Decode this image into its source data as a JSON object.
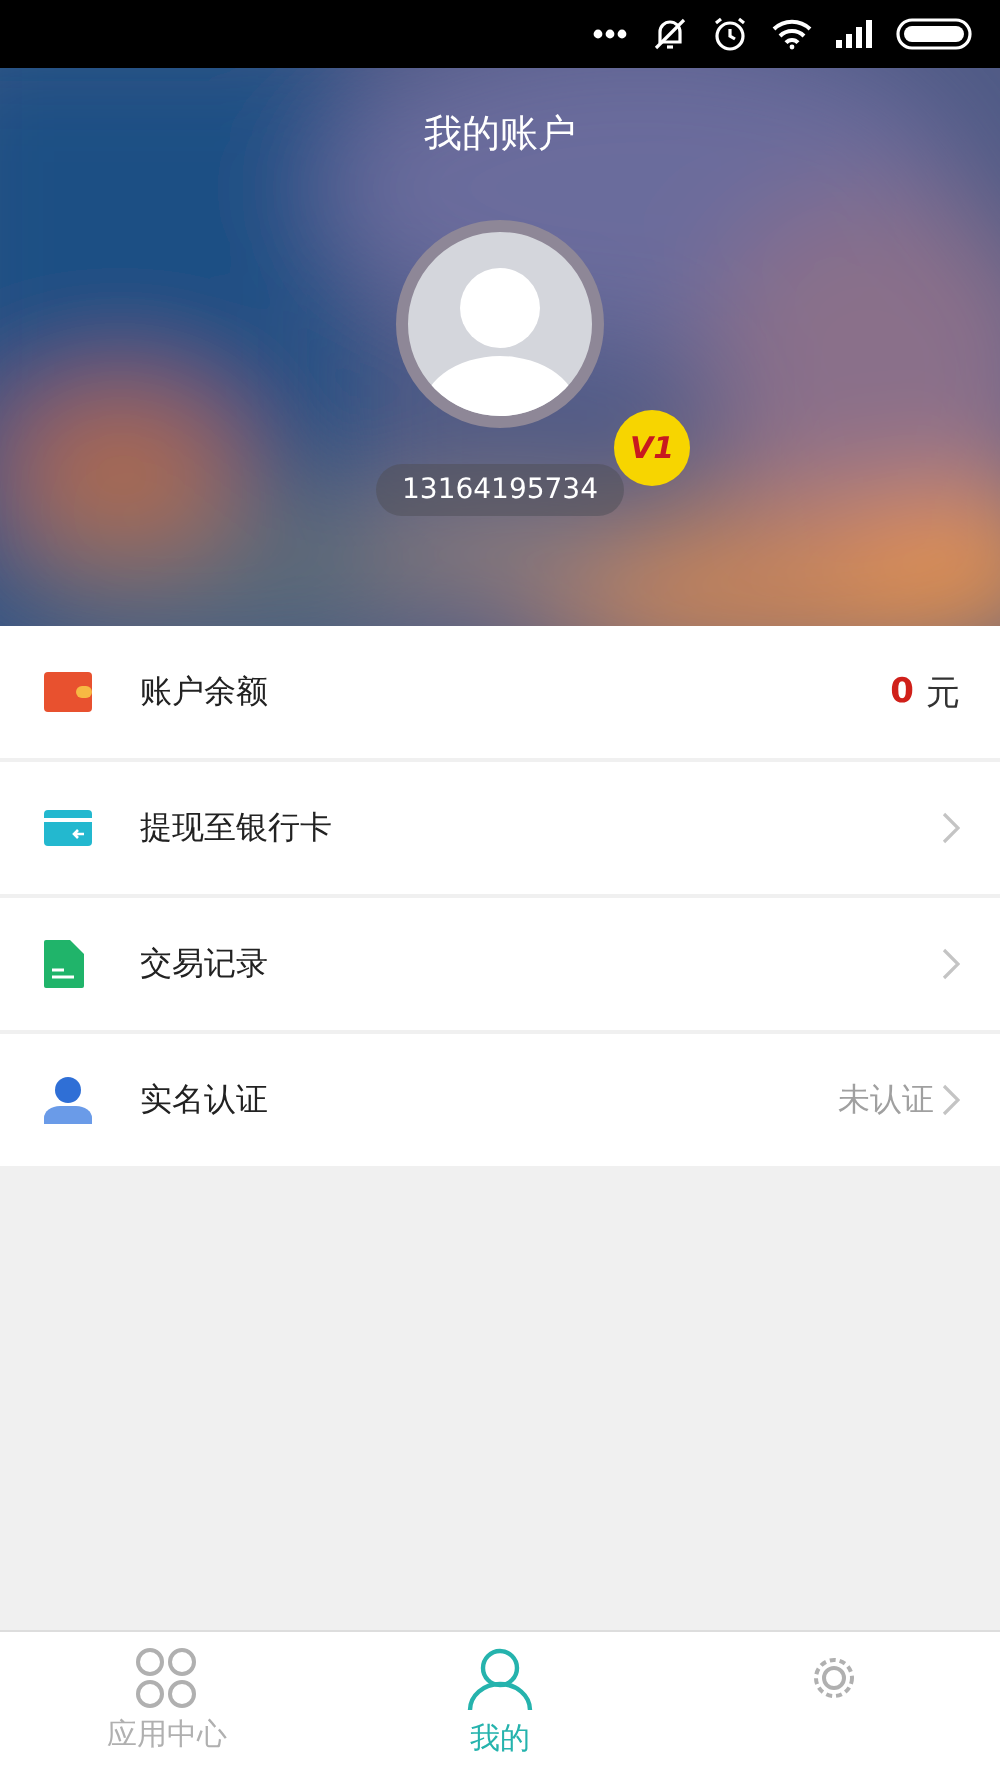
{
  "header": {
    "title": "我的账户",
    "phone": "13164195734",
    "level_badge": "V1"
  },
  "menu": [
    {
      "kind": "balance",
      "label": "账户余额",
      "amount": "0",
      "unit": "元",
      "chevron": false
    },
    {
      "kind": "card",
      "label": "提现至银行卡",
      "chevron": true
    },
    {
      "kind": "record",
      "label": "交易记录",
      "chevron": true
    },
    {
      "kind": "verify",
      "label": "实名认证",
      "status": "未认证",
      "chevron": true
    }
  ],
  "tabs": [
    {
      "kind": "apps",
      "label": "应用中心",
      "selected": false
    },
    {
      "kind": "me",
      "label": "我的",
      "selected": true
    },
    {
      "kind": "settings",
      "selected": false
    }
  ]
}
